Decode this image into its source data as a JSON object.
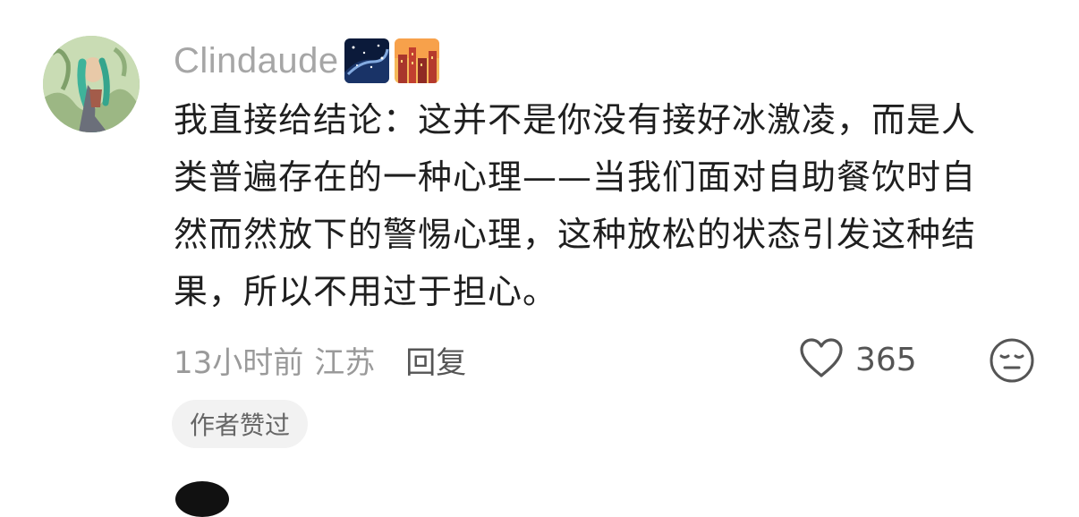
{
  "comment": {
    "username": "Clindaude",
    "badges": [
      "night-sky-badge",
      "city-sunset-badge"
    ],
    "text": "我直接给结论：这并不是你没有接好冰激凌，而是人\n类普遍存在的一种心理——当我们面对自助餐饮时自\n然而然放下的警惕心理，这种放松的状态引发这种结\n果，所以不用过于担心。",
    "time": "13小时前",
    "location": "江苏",
    "reply_label": "回复",
    "like_count": "365",
    "author_liked_label": "作者赞过"
  },
  "icons": {
    "like": "heart-outline-icon",
    "emoji": "emoji-face-icon"
  },
  "colors": {
    "username": "#a6a6a6",
    "meta": "#9a9a9a",
    "body_text": "#1f1f1f",
    "pill_bg": "#f2f2f2"
  }
}
